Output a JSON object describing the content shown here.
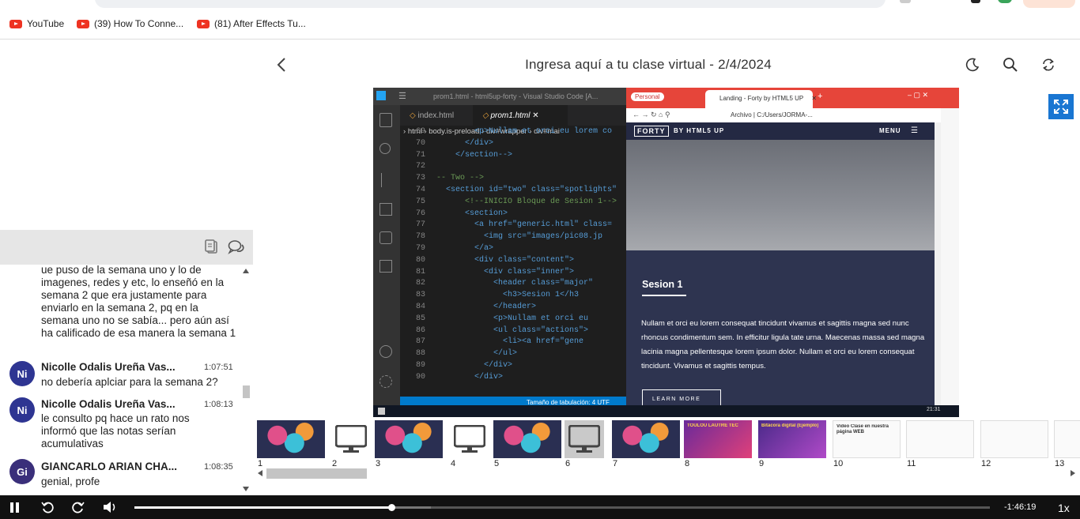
{
  "bookmarks": [
    {
      "label": "YouTube",
      "icon": "youtube-icon"
    },
    {
      "label": "(39) How To Conne...",
      "icon": "youtube-icon"
    },
    {
      "label": "(81) After Effects Tu...",
      "icon": "youtube-icon"
    }
  ],
  "header": {
    "title": "Ingresa aquí a tu clase virtual - 2/4/2024"
  },
  "chat": {
    "partial_message": "ue puso de la semana uno y lo de imagenes, redes y etc, lo enseñó en la semana 2  que era justamente para enviarlo en la semana 2, pq en la semana uno no se sabía... pero aún así ha calificado de esa manera la semana 1",
    "messages": [
      {
        "initials": "Ni",
        "name": "Nicolle Odalis Ureña Vas...",
        "time": "1:07:51",
        "text": "no debería aplciar para la semana 2?"
      },
      {
        "initials": "Ni",
        "name": "Nicolle Odalis Ureña Vas...",
        "time": "1:08:13",
        "text": "le consulto pq hace un rato nos informó que las notas serían acumulativas"
      },
      {
        "initials": "Gi",
        "name": "GIANCARLO ARIAN CHA...",
        "time": "1:08:35",
        "text": "genial, profe"
      }
    ]
  },
  "slide": {
    "vscode": {
      "title": "prom1.html - html5up-forty - Visual Studio Code [A...",
      "tabs": [
        "index.html",
        "prom1.html"
      ],
      "breadcrumb": [
        "html",
        "body.is-preload",
        "div#wrapper",
        "div#mai"
      ],
      "lines": [
        {
          "n": "69",
          "t": "        <p>Nullam et orci eu lorem co"
        },
        {
          "n": "70",
          "t": "      </div>"
        },
        {
          "n": "71",
          "t": "    </section-->"
        },
        {
          "n": "72",
          "t": ""
        },
        {
          "n": "73",
          "t": "-- Two -->"
        },
        {
          "n": "74",
          "t": "  <section id=\"two\" class=\"spotlights\""
        },
        {
          "n": "75",
          "t": "      <!--INICIO Bloque de Sesion 1-->"
        },
        {
          "n": "76",
          "t": "      <section>"
        },
        {
          "n": "77",
          "t": "        <a href=\"generic.html\" class="
        },
        {
          "n": "78",
          "t": "          <img src=\"images/pic08.jp"
        },
        {
          "n": "79",
          "t": "        </a>"
        },
        {
          "n": "80",
          "t": "        <div class=\"content\">"
        },
        {
          "n": "81",
          "t": "          <div class=\"inner\">"
        },
        {
          "n": "82",
          "t": "            <header class=\"major\""
        },
        {
          "n": "83",
          "t": "              <h3>Sesion 1</h3"
        },
        {
          "n": "84",
          "t": "            </header>"
        },
        {
          "n": "85",
          "t": "            <p>Nullam et orci eu"
        },
        {
          "n": "86",
          "t": "            <ul class=\"actions\">"
        },
        {
          "n": "87",
          "t": "              <li><a href=\"gene"
        },
        {
          "n": "88",
          "t": "            </ul>"
        },
        {
          "n": "89",
          "t": "          </div>"
        },
        {
          "n": "90",
          "t": "        </div>"
        }
      ],
      "status": "Tamaño de tabulación: 4     UTF"
    },
    "browser": {
      "profile": "Personal",
      "tab": "Landing - Forty by HTML5 UP",
      "address_prefix": "Archivo",
      "address": "C:/Users/JORMA-...",
      "brand": "FORTY",
      "brand_suffix": "BY HTML5 UP",
      "menu": "MENU",
      "heading": "Sesion 1",
      "body": "Nullam et orci eu lorem consequat tincidunt vivamus et sagittis magna sed nunc rhoncus condimentum sem. In efficitur ligula tate urna. Maecenas massa sed magna lacinia magna pellentesque lorem ipsum dolor. Nullam et orci eu lorem consequat tincidunt. Vivamus et sagittis tempus.",
      "button": "LEARN MORE"
    },
    "clock": "21:31"
  },
  "thumbnails": [
    {
      "num": "1",
      "kind": "art"
    },
    {
      "num": "2",
      "kind": "monitor"
    },
    {
      "num": "3",
      "kind": "art"
    },
    {
      "num": "4",
      "kind": "monitor"
    },
    {
      "num": "5",
      "kind": "art"
    },
    {
      "num": "6",
      "kind": "monitor",
      "selected": true
    },
    {
      "num": "7",
      "kind": "art"
    },
    {
      "num": "8",
      "kind": "purple",
      "text": "TOULOU LAUTRE TEC"
    },
    {
      "num": "9",
      "kind": "violet",
      "text": "Bitácora digital (Ejemplo)"
    },
    {
      "num": "10",
      "kind": "doc",
      "text": "Video Clase en nuestra página WEB"
    },
    {
      "num": "11",
      "kind": "doc"
    },
    {
      "num": "12",
      "kind": "doc"
    },
    {
      "num": "13",
      "kind": "doc"
    }
  ],
  "player": {
    "remaining": "-1:46:19",
    "speed": "1x",
    "progress": 0.3
  }
}
